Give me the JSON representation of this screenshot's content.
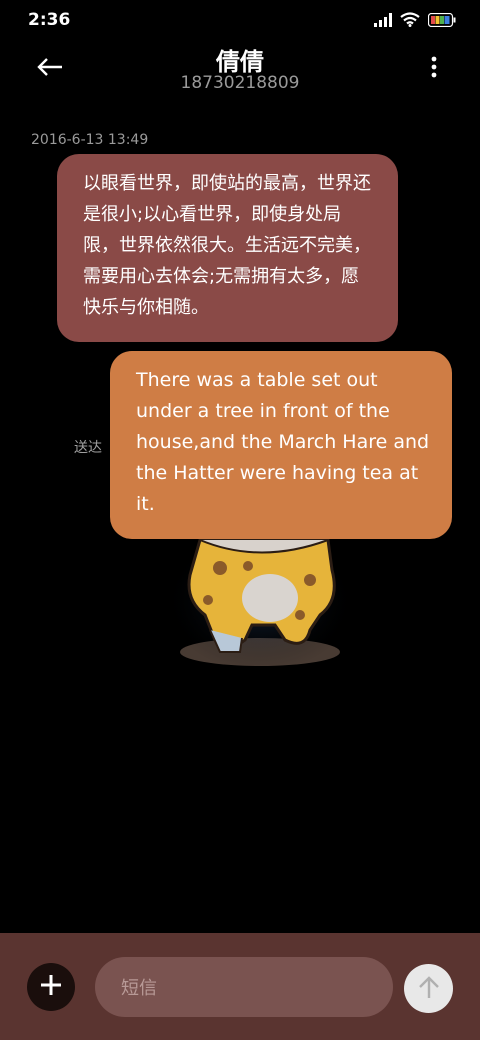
{
  "status_bar": {
    "time": "2:36",
    "icons": [
      "signal-icon",
      "wifi-icon",
      "battery-icon"
    ]
  },
  "header": {
    "title": "倩倩",
    "subtitle": "18730218809",
    "back_icon": "back-arrow-icon",
    "menu_icon": "more-vertical-icon"
  },
  "conversation": {
    "timestamp": "2016-6-13 13:49",
    "received_message": "以眼看世界，即使站的最高，世界还是很小;以心看世界，即使身处局限，世界依然很大。生活远不完美，需要用心去体会;无需拥有太多，愿快乐与你相随。",
    "sent_message": "There was a table set out under a tree in front of the house,and the March Hare and the Hatter were having tea at it.",
    "delivered_status": "送达"
  },
  "input_bar": {
    "placeholder": "短信",
    "add_icon": "plus-icon",
    "send_icon": "arrow-up-icon"
  },
  "colors": {
    "received_bubble": "#8a4a47",
    "sent_bubble": "#cf7d45",
    "input_bar_bg": "#5a3430"
  }
}
